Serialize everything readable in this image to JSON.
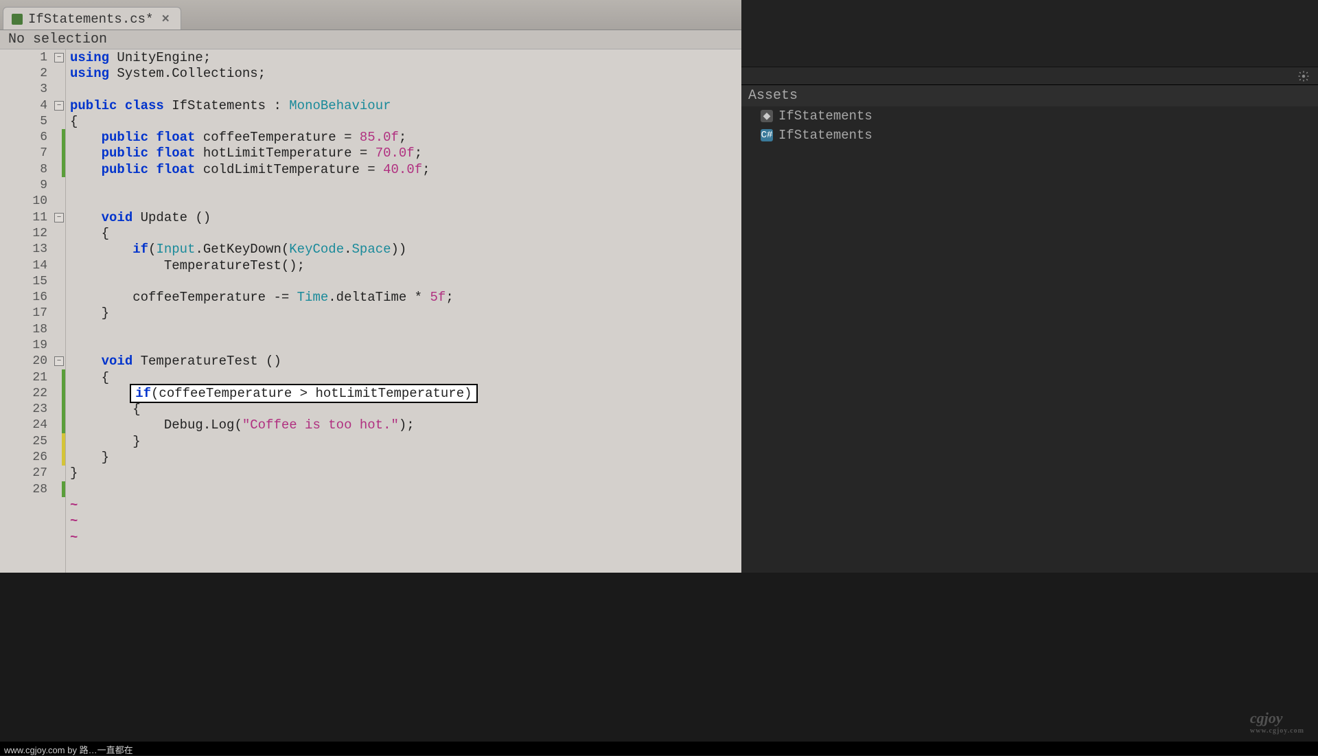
{
  "tab": {
    "filename": "IfStatements.cs*",
    "close": "×"
  },
  "breadcrumb": "No selection",
  "gutter": {
    "lines": [
      {
        "n": 1,
        "fold": true
      },
      {
        "n": 2
      },
      {
        "n": 3
      },
      {
        "n": 4,
        "fold": true
      },
      {
        "n": 5
      },
      {
        "n": 6,
        "change": "green"
      },
      {
        "n": 7,
        "change": "green"
      },
      {
        "n": 8,
        "change": "green"
      },
      {
        "n": 9
      },
      {
        "n": 10
      },
      {
        "n": 11,
        "fold": true
      },
      {
        "n": 12
      },
      {
        "n": 13
      },
      {
        "n": 14
      },
      {
        "n": 15
      },
      {
        "n": 16
      },
      {
        "n": 17
      },
      {
        "n": 18
      },
      {
        "n": 19
      },
      {
        "n": 20,
        "fold": true
      },
      {
        "n": 21,
        "change": "green"
      },
      {
        "n": 22,
        "change": "green"
      },
      {
        "n": 23,
        "change": "green"
      },
      {
        "n": 24,
        "change": "green"
      },
      {
        "n": 25,
        "change": "yellow"
      },
      {
        "n": 26,
        "change": "yellow"
      },
      {
        "n": 27
      },
      {
        "n": 28,
        "change": "green"
      }
    ]
  },
  "code": {
    "l1": {
      "kw1": "using",
      "t1": " UnityEngine;"
    },
    "l2": {
      "kw1": "using",
      "t1": " System.Collections;"
    },
    "l4": {
      "kw1": "public",
      "kw2": "class",
      "t1": " IfStatements : ",
      "type1": "MonoBehaviour"
    },
    "l5": {
      "t": "{"
    },
    "l6": {
      "kw1": "public",
      "kw2": "float",
      "t1": " coffeeTemperature = ",
      "num": "85.0f",
      "t2": ";"
    },
    "l7": {
      "kw1": "public",
      "kw2": "float",
      "t1": " hotLimitTemperature = ",
      "num": "70.0f",
      "t2": ";"
    },
    "l8": {
      "kw1": "public",
      "kw2": "float",
      "t1": " coldLimitTemperature = ",
      "num": "40.0f",
      "t2": ";"
    },
    "l11": {
      "kw1": "void",
      "t1": " Update ()"
    },
    "l12": {
      "t": "    {"
    },
    "l13": {
      "kw1": "if",
      "t1": "(",
      "type1": "Input",
      "t2": ".GetKeyDown(",
      "type2": "KeyCode",
      "t3": ".",
      "type3": "Space",
      "t4": "))"
    },
    "l14": {
      "t": "            TemperatureTest();"
    },
    "l16": {
      "t1": "        coffeeTemperature -= ",
      "type1": "Time",
      "t2": ".deltaTime * ",
      "num": "5f",
      "t3": ";"
    },
    "l17": {
      "t": "    }"
    },
    "l20": {
      "kw1": "void",
      "t1": " TemperatureTest ()"
    },
    "l21": {
      "t": "    {"
    },
    "l22": {
      "kw1": "if",
      "t1": "(coffeeTemperature > hotLimitTemperature)"
    },
    "l23": {
      "t": "        {"
    },
    "l24": {
      "t1": "            Debug.Log(",
      "str": "\"Coffee is too hot.\"",
      "t2": ");"
    },
    "l25": {
      "t": "        }"
    },
    "l26": {
      "t": "    }"
    },
    "l27": {
      "t": "}"
    },
    "tilde": "~"
  },
  "assets": {
    "header": "Assets",
    "items": [
      {
        "icon": "unity",
        "label": "IfStatements"
      },
      {
        "icon": "cs",
        "label": "IfStatements"
      }
    ]
  },
  "watermark": {
    "main": "cgjoy",
    "sub": "www.cgjoy.com"
  },
  "footer": "www.cgjoy.com by 路…一直都在"
}
